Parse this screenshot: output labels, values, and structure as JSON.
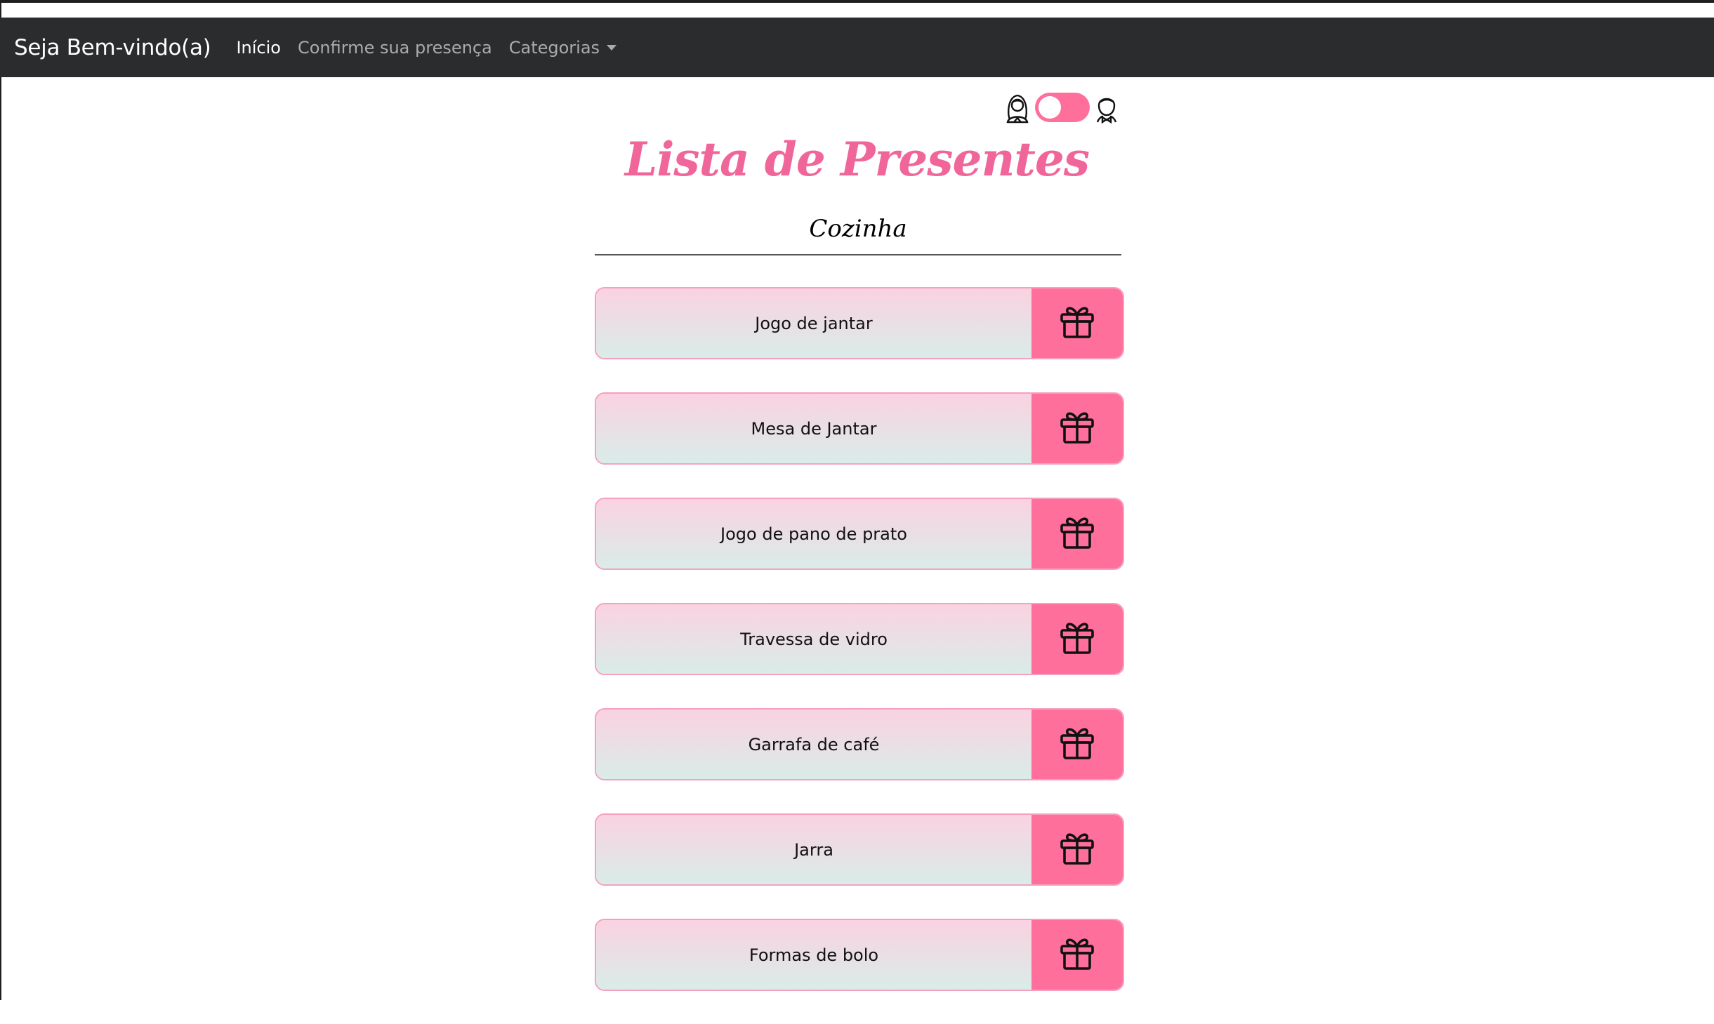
{
  "navbar": {
    "brand": "Seja Bem-vindo(a)",
    "links": [
      {
        "label": "Início",
        "active": true
      },
      {
        "label": "Confirme sua presença",
        "active": false
      },
      {
        "label": "Categorias",
        "active": false,
        "dropdown": true
      }
    ]
  },
  "theme_toggle": {
    "left_icon": "bride-icon",
    "right_icon": "groom-icon",
    "state": "left"
  },
  "page": {
    "title": "Lista de Presentes",
    "category": "Cozinha"
  },
  "gifts": [
    {
      "name": "Jogo de jantar",
      "icon": "gift-icon"
    },
    {
      "name": "Mesa de Jantar",
      "icon": "gift-icon"
    },
    {
      "name": "Jogo de pano de prato",
      "icon": "gift-icon"
    },
    {
      "name": "Travessa de vidro",
      "icon": "gift-icon"
    },
    {
      "name": "Garrafa de café",
      "icon": "gift-icon"
    },
    {
      "name": "Jarra",
      "icon": "gift-icon"
    },
    {
      "name": "Formas de bolo",
      "icon": "gift-icon"
    }
  ],
  "colors": {
    "accent": "#ff6f9b",
    "title": "#f0669a",
    "navbar": "#2b2c2e"
  }
}
